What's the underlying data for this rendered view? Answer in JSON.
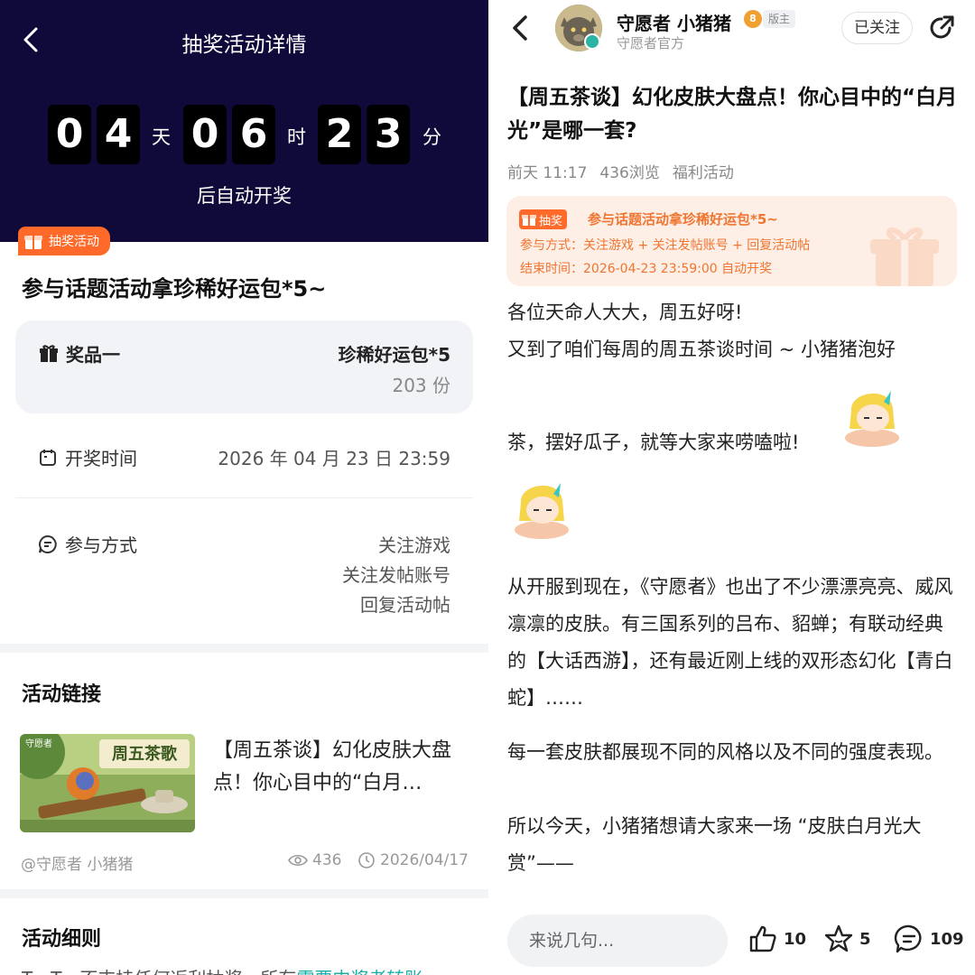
{
  "left": {
    "header_title": "抽奖活动详情",
    "countdown": {
      "days": [
        "0",
        "4"
      ],
      "days_unit": "天",
      "hours": [
        "0",
        "6"
      ],
      "hours_unit": "时",
      "minutes": [
        "2",
        "3"
      ],
      "minutes_unit": "分",
      "subtitle": "后自动开奖"
    },
    "badge": "抽奖活动",
    "activity_title": "参与话题活动拿珍稀好运包*5~",
    "prize": {
      "label": "奖品一",
      "name": "珍稀好运包*5",
      "count": "203 份"
    },
    "draw_time": {
      "label": "开奖时间",
      "value": "2026 年 04 月 23 日 23:59"
    },
    "participation": {
      "label": "参与方式",
      "items": [
        "关注游戏",
        "关注发帖账号",
        "回复活动帖"
      ]
    },
    "link_section": {
      "heading": "活动链接",
      "thumb_logo": "守愿者",
      "thumb_text": "周五茶歌",
      "title": "【周五茶谈】幻化皮肤大盘点！你心目中的“白月…",
      "author": "@守愿者 小猪猪",
      "views": "436",
      "date": "2026/04/17"
    },
    "rules_section": {
      "heading": "活动细则",
      "text_prefix": "T，T，不支持任何返利抽奖，所有",
      "text_highlight": "需要中奖者转账"
    }
  },
  "right": {
    "author": {
      "name": "守愿者 小猪猪",
      "level": "8",
      "role_tag": "版主",
      "subtitle": "守愿者官方"
    },
    "follow_label": "已关注",
    "post_title": "【周五茶谈】幻化皮肤大盘点！你心目中的“白月光”是哪一套?",
    "meta": {
      "time": "前天 11:17",
      "views": "436浏览",
      "category": "福利活动"
    },
    "lottery_card": {
      "tag": "抽奖",
      "title": "参与话题活动拿珍稀好运包*5~",
      "method": "参与方式：关注游戏 + 关注发帖账号 + 回复活动帖",
      "end_time": "结束时间：2026-04-23 23:59:00 自动开奖"
    },
    "paragraphs": {
      "p1": "各位天命人大大，周五好呀!",
      "p2a": "又到了咱们每周的周五茶谈时间 ~ 小猪猪泡好",
      "p2b": "茶，摆好瓜子，就等大家来唠嗑啦!",
      "p3": "从开服到现在，《守愿者》也出了不少漂漂亮亮、威风凛凛的皮肤。有三国系列的吕布、貂蝉；有联动经典的【大话西游】，还有最近刚上线的双形态幻化【青白蛇】……",
      "p4": "每一套皮肤都展现不同的风格以及不同的强度表现。",
      "p5": "所以今天，小猪猪想请大家来一场 “皮肤白月光大赏”——"
    },
    "bottom_bar": {
      "input_placeholder": "来说几句...",
      "likes": "10",
      "favorites": "5",
      "comments": "109"
    }
  }
}
